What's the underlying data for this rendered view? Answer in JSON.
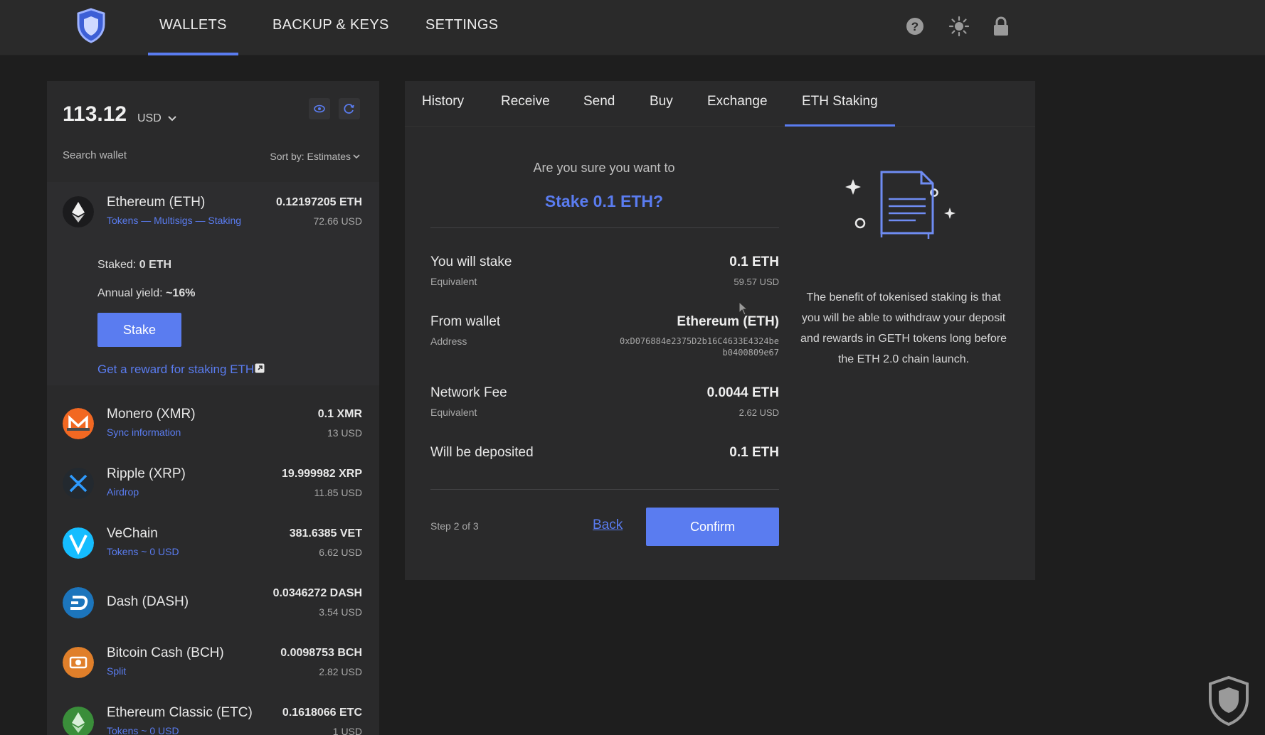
{
  "nav": {
    "tabs": [
      "WALLETS",
      "BACKUP & KEYS",
      "SETTINGS"
    ],
    "active": "WALLETS",
    "icons": [
      "shield-logo-icon",
      "help-icon",
      "sun-icon",
      "lock-icon"
    ]
  },
  "wallet_panel": {
    "balance": "113.12",
    "currency": "USD",
    "search_placeholder": "Search wallet",
    "sort_label": "Sort by: Estimates",
    "wallets": [
      {
        "name": "Ethereum (ETH)",
        "sub": "Tokens — Multisigs — Staking",
        "amount": "0.12197205 ETH",
        "usd": "72.66 USD",
        "icon_color": "#1b1b1d",
        "icon": "ethereum-icon"
      },
      {
        "name": "Monero (XMR)",
        "sub": "Sync information",
        "amount": "0.1 XMR",
        "usd": "13 USD",
        "icon_color": "#f26822",
        "icon": "monero-icon"
      },
      {
        "name": "Ripple (XRP)",
        "sub": "Airdrop",
        "amount": "19.999982 XRP",
        "usd": "11.85 USD",
        "icon_color": "#23292f",
        "icon": "ripple-icon"
      },
      {
        "name": "VeChain",
        "sub": "Tokens ~ 0 USD",
        "amount": "381.6385 VET",
        "usd": "6.62 USD",
        "icon_color": "#15bdff",
        "icon": "vechain-icon"
      },
      {
        "name": "Dash (DASH)",
        "sub": "",
        "amount": "0.0346272 DASH",
        "usd": "3.54 USD",
        "icon_color": "#1c75bc",
        "icon": "dash-icon"
      },
      {
        "name": "Bitcoin Cash (BCH)",
        "sub": "Split",
        "amount": "0.0098753 BCH",
        "usd": "2.82 USD",
        "icon_color": "#e07f2a",
        "icon": "bitcoin-cash-icon"
      },
      {
        "name": "Ethereum Classic (ETC)",
        "sub": "Tokens ~ 0 USD",
        "amount": "0.1618066 ETC",
        "usd": "1 USD",
        "icon_color": "#3a8e3a",
        "icon": "ethereum-classic-icon"
      }
    ],
    "eth_detail": {
      "staked_label": "Staked:",
      "staked_value": "0 ETH",
      "yield_label": "Annual yield:",
      "yield_value": "~16%",
      "stake_button": "Stake",
      "reward_link": "Get a reward for staking ETH"
    }
  },
  "main": {
    "tabs": [
      "History",
      "Receive",
      "Send",
      "Buy",
      "Exchange",
      "ETH Staking"
    ],
    "active_tab": "ETH Staking",
    "question": "Are you sure you want to",
    "title": "Stake 0.1 ETH?",
    "rows": {
      "stake_label": "You will stake",
      "stake_value": "0.1 ETH",
      "stake_sub": "Equivalent",
      "stake_subval": "59.57 USD",
      "wallet_label": "From wallet",
      "wallet_value": "Ethereum (ETH)",
      "wallet_sub": "Address",
      "address_line1": "0xD076884e2375D2b16C4633E4324be",
      "address_line2": "b0400809e67",
      "fee_label": "Network Fee",
      "fee_value": "0.0044 ETH",
      "fee_sub": "Equivalent",
      "fee_subval": "2.62 USD",
      "deposit_label": "Will be deposited",
      "deposit_value": "0.1 ETH"
    },
    "step": "Step 2 of 3",
    "back": "Back",
    "confirm": "Confirm",
    "info_text": "The benefit of tokenised staking is that you will be able to withdraw your deposit and rewards in GETH tokens long before the ETH 2.0 chain launch."
  },
  "colors": {
    "accent": "#5a7cf0",
    "background": "#1e1e1e",
    "panel": "#2a2a2b"
  }
}
